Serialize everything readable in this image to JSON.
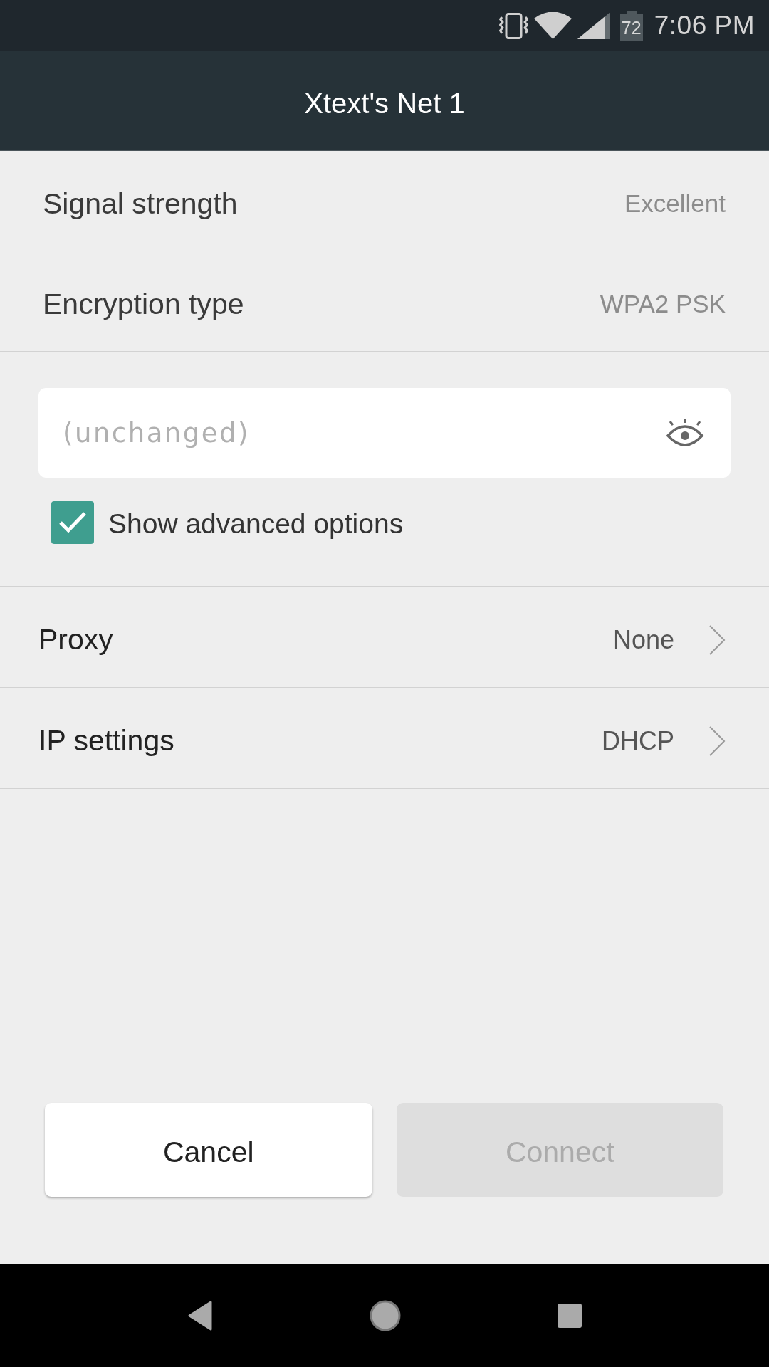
{
  "status_bar": {
    "battery": "72",
    "time": "7:06 PM"
  },
  "title": "Xtext's Net 1",
  "info_rows": [
    {
      "label": "Signal strength",
      "value": "Excellent"
    },
    {
      "label": "Encryption type",
      "value": "WPA2 PSK"
    }
  ],
  "password_field": {
    "placeholder": "(unchanged)"
  },
  "advanced_checkbox": {
    "label": "Show advanced options",
    "checked": true
  },
  "settings_rows": [
    {
      "label": "Proxy",
      "value": "None"
    },
    {
      "label": "IP settings",
      "value": "DHCP"
    }
  ],
  "buttons": [
    {
      "label": "Cancel",
      "disabled": false
    },
    {
      "label": "Connect",
      "disabled": true
    }
  ]
}
